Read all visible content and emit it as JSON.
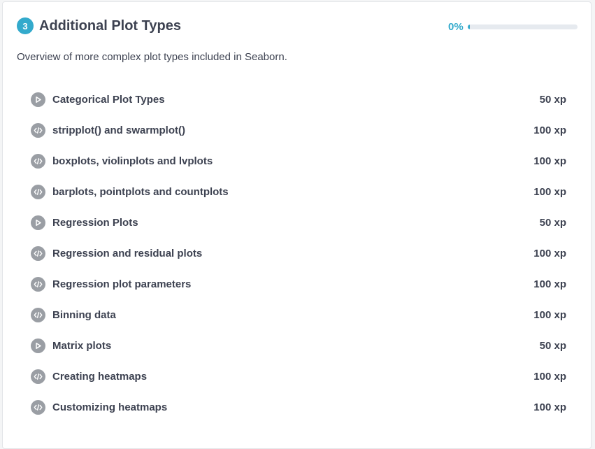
{
  "chapter": {
    "number": "3",
    "title": "Additional Plot Types",
    "progress_label": "0%",
    "progress_fraction": 0,
    "description": "Overview of more complex plot types included in Seaborn."
  },
  "colors": {
    "accent": "#33aacc",
    "icon_bg": "#9a9ea4",
    "text": "#3d4251"
  },
  "exercises": [
    {
      "type": "video",
      "icon": "play-icon",
      "title": "Categorical Plot Types",
      "xp": "50 xp"
    },
    {
      "type": "code",
      "icon": "code-icon",
      "title": "stripplot() and swarmplot()",
      "xp": "100 xp"
    },
    {
      "type": "code",
      "icon": "code-icon",
      "title": "boxplots, violinplots and lvplots",
      "xp": "100 xp"
    },
    {
      "type": "code",
      "icon": "code-icon",
      "title": "barplots, pointplots and countplots",
      "xp": "100 xp"
    },
    {
      "type": "video",
      "icon": "play-icon",
      "title": "Regression Plots",
      "xp": "50 xp"
    },
    {
      "type": "code",
      "icon": "code-icon",
      "title": "Regression and residual plots",
      "xp": "100 xp"
    },
    {
      "type": "code",
      "icon": "code-icon",
      "title": "Regression plot parameters",
      "xp": "100 xp"
    },
    {
      "type": "code",
      "icon": "code-icon",
      "title": "Binning data",
      "xp": "100 xp"
    },
    {
      "type": "video",
      "icon": "play-icon",
      "title": "Matrix plots",
      "xp": "50 xp"
    },
    {
      "type": "code",
      "icon": "code-icon",
      "title": "Creating heatmaps",
      "xp": "100 xp"
    },
    {
      "type": "code",
      "icon": "code-icon",
      "title": "Customizing heatmaps",
      "xp": "100 xp"
    }
  ]
}
